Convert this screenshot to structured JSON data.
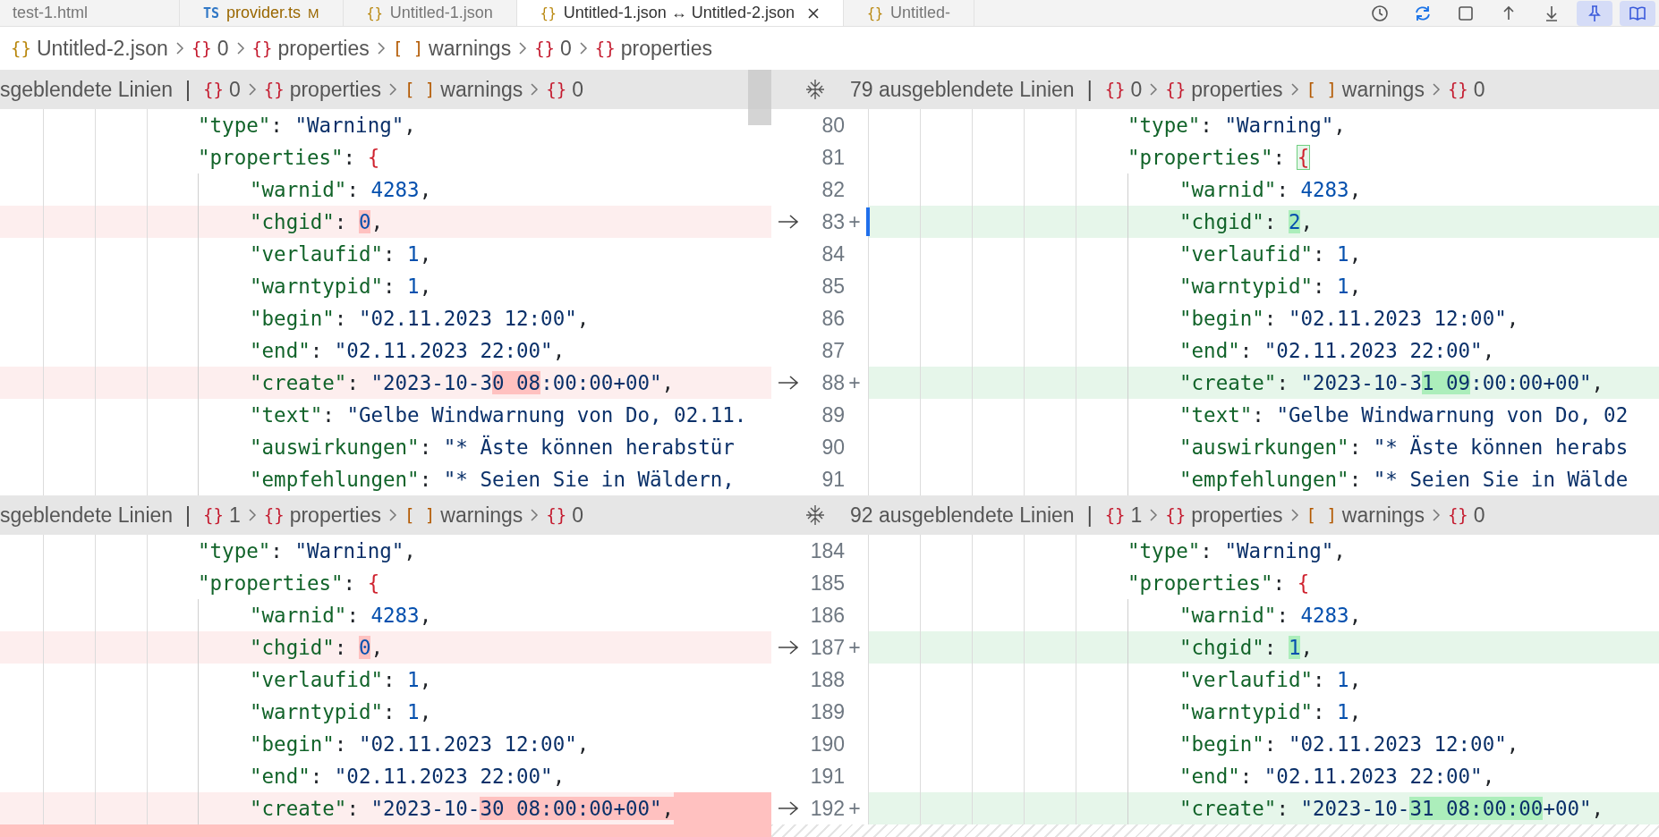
{
  "tabs": [
    {
      "label": "test-1.html",
      "selected": false
    },
    {
      "label": "provider.ts",
      "kind": "ts",
      "icon": "TS",
      "badge": "M",
      "selected": false
    },
    {
      "label": "Untitled-1.json",
      "kind": "json",
      "icon": "{}",
      "selected": false
    },
    {
      "label": "Untitled-1.json ↔ Untitled-2.json",
      "kind": "json",
      "icon": "{}",
      "selected": true
    },
    {
      "label": "Untitled-",
      "kind": "json",
      "icon": "{}",
      "selected": false
    }
  ],
  "toolbar": [
    {
      "kind": "history",
      "active": false
    },
    {
      "kind": "sync",
      "active": false
    },
    {
      "kind": "square",
      "active": false
    },
    {
      "kind": "up",
      "active": false
    },
    {
      "kind": "down",
      "active": false
    },
    {
      "kind": "pin",
      "active": true
    },
    {
      "kind": "book",
      "active": true
    }
  ],
  "breadcrumb": [
    {
      "icon": "{}",
      "kind": "file",
      "label": "Untitled-2.json"
    },
    {
      "icon": "{}",
      "kind": "object",
      "label": "0"
    },
    {
      "icon": "{}",
      "kind": "object",
      "label": "properties"
    },
    {
      "icon": "[ ]",
      "kind": "array",
      "label": "warnings"
    },
    {
      "icon": "{}",
      "kind": "object",
      "label": "0"
    },
    {
      "icon": "{}",
      "kind": "object",
      "label": "properties"
    }
  ],
  "sections": [
    {
      "left": {
        "header": {
          "hidden_lines": "sgeblendete Linien",
          "separator": "|",
          "crumbs": [
            {
              "icon": "{}",
              "kind": "object",
              "label": "0"
            },
            {
              "icon": "{}",
              "kind": "object",
              "label": "properties"
            },
            {
              "icon": "[ ]",
              "kind": "array",
              "label": "warnings"
            },
            {
              "icon": "{}",
              "kind": "object",
              "label": "0"
            }
          ]
        },
        "lines": [
          {
            "kind": "plain",
            "segments": [
              {
                "t": "\"type\"",
                "kind": "key"
              },
              {
                "t": ": ",
                "kind": "punct"
              },
              {
                "t": "\"Warning\"",
                "kind": "str"
              },
              {
                "t": ",",
                "kind": "punct"
              }
            ]
          },
          {
            "kind": "plain",
            "segments": [
              {
                "t": "\"properties\"",
                "kind": "key"
              },
              {
                "t": ": ",
                "kind": "punct"
              },
              {
                "t": "{",
                "kind": "brace"
              }
            ],
            "children": [
              {
                "kind": "plain",
                "segments": [
                  {
                    "t": "\"warnid\"",
                    "kind": "key"
                  },
                  {
                    "t": ": ",
                    "kind": "punct"
                  },
                  {
                    "t": "4283",
                    "kind": "num"
                  },
                  {
                    "t": ",",
                    "kind": "punct"
                  }
                ]
              },
              {
                "kind": "removed",
                "segments": [
                  {
                    "t": "\"chgid\"",
                    "kind": "key"
                  },
                  {
                    "t": ": ",
                    "kind": "punct"
                  },
                  {
                    "t": "0",
                    "kind": "num",
                    "changed": true
                  },
                  {
                    "t": ",",
                    "kind": "punct"
                  }
                ]
              },
              {
                "kind": "plain",
                "segments": [
                  {
                    "t": "\"verlaufid\"",
                    "kind": "key"
                  },
                  {
                    "t": ": ",
                    "kind": "punct"
                  },
                  {
                    "t": "1",
                    "kind": "num"
                  },
                  {
                    "t": ",",
                    "kind": "punct"
                  }
                ]
              },
              {
                "kind": "plain",
                "segments": [
                  {
                    "t": "\"warntypid\"",
                    "kind": "key"
                  },
                  {
                    "t": ": ",
                    "kind": "punct"
                  },
                  {
                    "t": "1",
                    "kind": "num"
                  },
                  {
                    "t": ",",
                    "kind": "punct"
                  }
                ]
              },
              {
                "kind": "plain",
                "segments": [
                  {
                    "t": "\"begin\"",
                    "kind": "key"
                  },
                  {
                    "t": ": ",
                    "kind": "punct"
                  },
                  {
                    "t": "\"02.11.2023 12:00\"",
                    "kind": "str"
                  },
                  {
                    "t": ",",
                    "kind": "punct"
                  }
                ]
              },
              {
                "kind": "plain",
                "segments": [
                  {
                    "t": "\"end\"",
                    "kind": "key"
                  },
                  {
                    "t": ": ",
                    "kind": "punct"
                  },
                  {
                    "t": "\"02.11.2023 22:00\"",
                    "kind": "str"
                  },
                  {
                    "t": ",",
                    "kind": "punct"
                  }
                ]
              },
              {
                "kind": "removed",
                "segments": [
                  {
                    "t": "\"create\"",
                    "kind": "key"
                  },
                  {
                    "t": ": ",
                    "kind": "punct"
                  },
                  {
                    "t": "\"2023-10-3",
                    "kind": "str"
                  },
                  {
                    "t": "0 08",
                    "kind": "str",
                    "changed": true
                  },
                  {
                    "t": ":00:00+00\"",
                    "kind": "str"
                  },
                  {
                    "t": ",",
                    "kind": "punct"
                  }
                ]
              },
              {
                "kind": "plain",
                "segments": [
                  {
                    "t": "\"text\"",
                    "kind": "key"
                  },
                  {
                    "t": ": ",
                    "kind": "punct"
                  },
                  {
                    "t": "\"Gelbe Windwarnung von Do, 02.11.",
                    "kind": "str"
                  }
                ]
              },
              {
                "kind": "plain",
                "segments": [
                  {
                    "t": "\"auswirkungen\"",
                    "kind": "key"
                  },
                  {
                    "t": ": ",
                    "kind": "punct"
                  },
                  {
                    "t": "\"* Äste können herabstür",
                    "kind": "str"
                  }
                ]
              },
              {
                "kind": "plain",
                "segments": [
                  {
                    "t": "\"empfehlungen\"",
                    "kind": "key"
                  },
                  {
                    "t": ": ",
                    "kind": "punct"
                  },
                  {
                    "t": "\"* Seien Sie in Wäldern,",
                    "kind": "str"
                  }
                ]
              }
            ]
          }
        ]
      },
      "right": {
        "header": {
          "hidden_lines": "79 ausgeblendete Linien",
          "separator": "|",
          "crumbs": [
            {
              "icon": "{}",
              "kind": "object",
              "label": "0"
            },
            {
              "icon": "{}",
              "kind": "object",
              "label": "properties"
            },
            {
              "icon": "[ ]",
              "kind": "array",
              "label": "warnings"
            },
            {
              "icon": "{}",
              "kind": "object",
              "label": "0"
            }
          ]
        },
        "lines": [
          {
            "kind": "plain",
            "number": "80",
            "cursor": false,
            "segments": [
              {
                "t": "\"type\"",
                "kind": "key"
              },
              {
                "t": ": ",
                "kind": "punct"
              },
              {
                "t": "\"Warning\"",
                "kind": "str"
              },
              {
                "t": ",",
                "kind": "punct"
              }
            ]
          },
          {
            "kind": "plain",
            "number": "81",
            "cursor": false,
            "segments": [
              {
                "t": "\"properties\"",
                "kind": "key"
              },
              {
                "t": ": ",
                "kind": "punct"
              },
              {
                "t": "{",
                "kind": "brace",
                "matched": true
              }
            ],
            "children": [
              {
                "kind": "plain",
                "number": "82",
                "cursor": false,
                "segments": [
                  {
                    "t": "\"warnid\"",
                    "kind": "key"
                  },
                  {
                    "t": ": ",
                    "kind": "punct"
                  },
                  {
                    "t": "4283",
                    "kind": "num"
                  },
                  {
                    "t": ",",
                    "kind": "punct"
                  }
                ]
              },
              {
                "kind": "added",
                "number": "83",
                "sign": "+",
                "cursor": true,
                "segments": [
                  {
                    "t": "\"chgid\"",
                    "kind": "key"
                  },
                  {
                    "t": ": ",
                    "kind": "punct"
                  },
                  {
                    "t": "2",
                    "kind": "num",
                    "changed": true
                  },
                  {
                    "t": ",",
                    "kind": "punct"
                  }
                ]
              },
              {
                "kind": "plain",
                "number": "84",
                "cursor": false,
                "segments": [
                  {
                    "t": "\"verlaufid\"",
                    "kind": "key"
                  },
                  {
                    "t": ": ",
                    "kind": "punct"
                  },
                  {
                    "t": "1",
                    "kind": "num"
                  },
                  {
                    "t": ",",
                    "kind": "punct"
                  }
                ]
              },
              {
                "kind": "plain",
                "number": "85",
                "cursor": false,
                "segments": [
                  {
                    "t": "\"warntypid\"",
                    "kind": "key"
                  },
                  {
                    "t": ": ",
                    "kind": "punct"
                  },
                  {
                    "t": "1",
                    "kind": "num"
                  },
                  {
                    "t": ",",
                    "kind": "punct"
                  }
                ]
              },
              {
                "kind": "plain",
                "number": "86",
                "cursor": false,
                "segments": [
                  {
                    "t": "\"begin\"",
                    "kind": "key"
                  },
                  {
                    "t": ": ",
                    "kind": "punct"
                  },
                  {
                    "t": "\"02.11.2023 12:00\"",
                    "kind": "str"
                  },
                  {
                    "t": ",",
                    "kind": "punct"
                  }
                ]
              },
              {
                "kind": "plain",
                "number": "87",
                "cursor": false,
                "segments": [
                  {
                    "t": "\"end\"",
                    "kind": "key"
                  },
                  {
                    "t": ": ",
                    "kind": "punct"
                  },
                  {
                    "t": "\"02.11.2023 22:00\"",
                    "kind": "str"
                  },
                  {
                    "t": ",",
                    "kind": "punct"
                  }
                ]
              },
              {
                "kind": "added",
                "number": "88",
                "sign": "+",
                "cursor": false,
                "segments": [
                  {
                    "t": "\"create\"",
                    "kind": "key"
                  },
                  {
                    "t": ": ",
                    "kind": "punct"
                  },
                  {
                    "t": "\"2023-10-3",
                    "kind": "str"
                  },
                  {
                    "t": "1 09",
                    "kind": "str",
                    "changed": true
                  },
                  {
                    "t": ":00:00+00\"",
                    "kind": "str"
                  },
                  {
                    "t": ",",
                    "kind": "punct"
                  }
                ]
              },
              {
                "kind": "plain",
                "number": "89",
                "cursor": false,
                "segments": [
                  {
                    "t": "\"text\"",
                    "kind": "key"
                  },
                  {
                    "t": ": ",
                    "kind": "punct"
                  },
                  {
                    "t": "\"Gelbe Windwarnung von Do, 02",
                    "kind": "str"
                  }
                ]
              },
              {
                "kind": "plain",
                "number": "90",
                "cursor": false,
                "segments": [
                  {
                    "t": "\"auswirkungen\"",
                    "kind": "key"
                  },
                  {
                    "t": ": ",
                    "kind": "punct"
                  },
                  {
                    "t": "\"* Äste können herabs",
                    "kind": "str"
                  }
                ]
              },
              {
                "kind": "plain",
                "number": "91",
                "cursor": false,
                "segments": [
                  {
                    "t": "\"empfehlungen\"",
                    "kind": "key"
                  },
                  {
                    "t": ": ",
                    "kind": "punct"
                  },
                  {
                    "t": "\"* Seien Sie in Wälde",
                    "kind": "str"
                  }
                ]
              }
            ]
          }
        ]
      }
    },
    {
      "left": {
        "header": {
          "hidden_lines": "sgeblendete Linien",
          "separator": "|",
          "crumbs": [
            {
              "icon": "{}",
              "kind": "object",
              "label": "1"
            },
            {
              "icon": "{}",
              "kind": "object",
              "label": "properties"
            },
            {
              "icon": "[ ]",
              "kind": "array",
              "label": "warnings"
            },
            {
              "icon": "{}",
              "kind": "object",
              "label": "0"
            }
          ]
        },
        "lines": [
          {
            "kind": "plain",
            "segments": [
              {
                "t": "\"type\"",
                "kind": "key"
              },
              {
                "t": ": ",
                "kind": "punct"
              },
              {
                "t": "\"Warning\"",
                "kind": "str"
              },
              {
                "t": ",",
                "kind": "punct"
              }
            ]
          },
          {
            "kind": "plain",
            "segments": [
              {
                "t": "\"properties\"",
                "kind": "key"
              },
              {
                "t": ": ",
                "kind": "punct"
              },
              {
                "t": "{",
                "kind": "brace"
              }
            ],
            "children": [
              {
                "kind": "plain",
                "segments": [
                  {
                    "t": "\"warnid\"",
                    "kind": "key"
                  },
                  {
                    "t": ": ",
                    "kind": "punct"
                  },
                  {
                    "t": "4283",
                    "kind": "num"
                  },
                  {
                    "t": ",",
                    "kind": "punct"
                  }
                ]
              },
              {
                "kind": "removed",
                "segments": [
                  {
                    "t": "\"chgid\"",
                    "kind": "key"
                  },
                  {
                    "t": ": ",
                    "kind": "punct"
                  },
                  {
                    "t": "0",
                    "kind": "num",
                    "changed": true
                  },
                  {
                    "t": ",",
                    "kind": "punct"
                  }
                ]
              },
              {
                "kind": "plain",
                "segments": [
                  {
                    "t": "\"verlaufid\"",
                    "kind": "key"
                  },
                  {
                    "t": ": ",
                    "kind": "punct"
                  },
                  {
                    "t": "1",
                    "kind": "num"
                  },
                  {
                    "t": ",",
                    "kind": "punct"
                  }
                ]
              },
              {
                "kind": "plain",
                "segments": [
                  {
                    "t": "\"warntypid\"",
                    "kind": "key"
                  },
                  {
                    "t": ": ",
                    "kind": "punct"
                  },
                  {
                    "t": "1",
                    "kind": "num"
                  },
                  {
                    "t": ",",
                    "kind": "punct"
                  }
                ]
              },
              {
                "kind": "plain",
                "segments": [
                  {
                    "t": "\"begin\"",
                    "kind": "key"
                  },
                  {
                    "t": ": ",
                    "kind": "punct"
                  },
                  {
                    "t": "\"02.11.2023 12:00\"",
                    "kind": "str"
                  },
                  {
                    "t": ",",
                    "kind": "punct"
                  }
                ]
              },
              {
                "kind": "plain",
                "segments": [
                  {
                    "t": "\"end\"",
                    "kind": "key"
                  },
                  {
                    "t": ": ",
                    "kind": "punct"
                  },
                  {
                    "t": "\"02.11.2023 22:00\"",
                    "kind": "str"
                  },
                  {
                    "t": ",",
                    "kind": "punct"
                  }
                ]
              },
              {
                "kind": "removed",
                "tail_changed": true,
                "segments": [
                  {
                    "t": "\"create\"",
                    "kind": "key"
                  },
                  {
                    "t": ": ",
                    "kind": "punct"
                  },
                  {
                    "t": "\"2023-10-",
                    "kind": "str"
                  },
                  {
                    "t": "30 08:00:00+00\"",
                    "kind": "str",
                    "changed": true
                  },
                  {
                    "t": ",",
                    "kind": "punct",
                    "changed": true
                  }
                ]
              }
            ]
          }
        ]
      },
      "right": {
        "header": {
          "hidden_lines": "92 ausgeblendete Linien",
          "separator": "|",
          "crumbs": [
            {
              "icon": "{}",
              "kind": "object",
              "label": "1"
            },
            {
              "icon": "{}",
              "kind": "object",
              "label": "properties"
            },
            {
              "icon": "[ ]",
              "kind": "array",
              "label": "warnings"
            },
            {
              "icon": "{}",
              "kind": "object",
              "label": "0"
            }
          ]
        },
        "lines": [
          {
            "kind": "plain",
            "number": "184",
            "cursor": false,
            "segments": [
              {
                "t": "\"type\"",
                "kind": "key"
              },
              {
                "t": ": ",
                "kind": "punct"
              },
              {
                "t": "\"Warning\"",
                "kind": "str"
              },
              {
                "t": ",",
                "kind": "punct"
              }
            ]
          },
          {
            "kind": "plain",
            "number": "185",
            "cursor": false,
            "segments": [
              {
                "t": "\"properties\"",
                "kind": "key"
              },
              {
                "t": ": ",
                "kind": "punct"
              },
              {
                "t": "{",
                "kind": "brace"
              }
            ],
            "children": [
              {
                "kind": "plain",
                "number": "186",
                "cursor": false,
                "segments": [
                  {
                    "t": "\"warnid\"",
                    "kind": "key"
                  },
                  {
                    "t": ": ",
                    "kind": "punct"
                  },
                  {
                    "t": "4283",
                    "kind": "num"
                  },
                  {
                    "t": ",",
                    "kind": "punct"
                  }
                ]
              },
              {
                "kind": "added",
                "number": "187",
                "sign": "+",
                "cursor": false,
                "segments": [
                  {
                    "t": "\"chgid\"",
                    "kind": "key"
                  },
                  {
                    "t": ": ",
                    "kind": "punct"
                  },
                  {
                    "t": "1",
                    "kind": "num",
                    "changed": true
                  },
                  {
                    "t": ",",
                    "kind": "punct"
                  }
                ]
              },
              {
                "kind": "plain",
                "number": "188",
                "cursor": false,
                "segments": [
                  {
                    "t": "\"verlaufid\"",
                    "kind": "key"
                  },
                  {
                    "t": ": ",
                    "kind": "punct"
                  },
                  {
                    "t": "1",
                    "kind": "num"
                  },
                  {
                    "t": ",",
                    "kind": "punct"
                  }
                ]
              },
              {
                "kind": "plain",
                "number": "189",
                "cursor": false,
                "segments": [
                  {
                    "t": "\"warntypid\"",
                    "kind": "key"
                  },
                  {
                    "t": ": ",
                    "kind": "punct"
                  },
                  {
                    "t": "1",
                    "kind": "num"
                  },
                  {
                    "t": ",",
                    "kind": "punct"
                  }
                ]
              },
              {
                "kind": "plain",
                "number": "190",
                "cursor": false,
                "segments": [
                  {
                    "t": "\"begin\"",
                    "kind": "key"
                  },
                  {
                    "t": ": ",
                    "kind": "punct"
                  },
                  {
                    "t": "\"02.11.2023 12:00\"",
                    "kind": "str"
                  },
                  {
                    "t": ",",
                    "kind": "punct"
                  }
                ]
              },
              {
                "kind": "plain",
                "number": "191",
                "cursor": false,
                "segments": [
                  {
                    "t": "\"end\"",
                    "kind": "key"
                  },
                  {
                    "t": ": ",
                    "kind": "punct"
                  },
                  {
                    "t": "\"02.11.2023 22:00\"",
                    "kind": "str"
                  },
                  {
                    "t": ",",
                    "kind": "punct"
                  }
                ]
              },
              {
                "kind": "added",
                "number": "192",
                "sign": "+",
                "cursor": false,
                "segments": [
                  {
                    "t": "\"create\"",
                    "kind": "key"
                  },
                  {
                    "t": ": ",
                    "kind": "punct"
                  },
                  {
                    "t": "\"2023-10-",
                    "kind": "str"
                  },
                  {
                    "t": "31 08:00:00",
                    "kind": "str",
                    "changed": true
                  },
                  {
                    "t": "+00\"",
                    "kind": "str"
                  },
                  {
                    "t": ",",
                    "kind": "punct"
                  }
                ]
              }
            ]
          }
        ]
      }
    }
  ]
}
